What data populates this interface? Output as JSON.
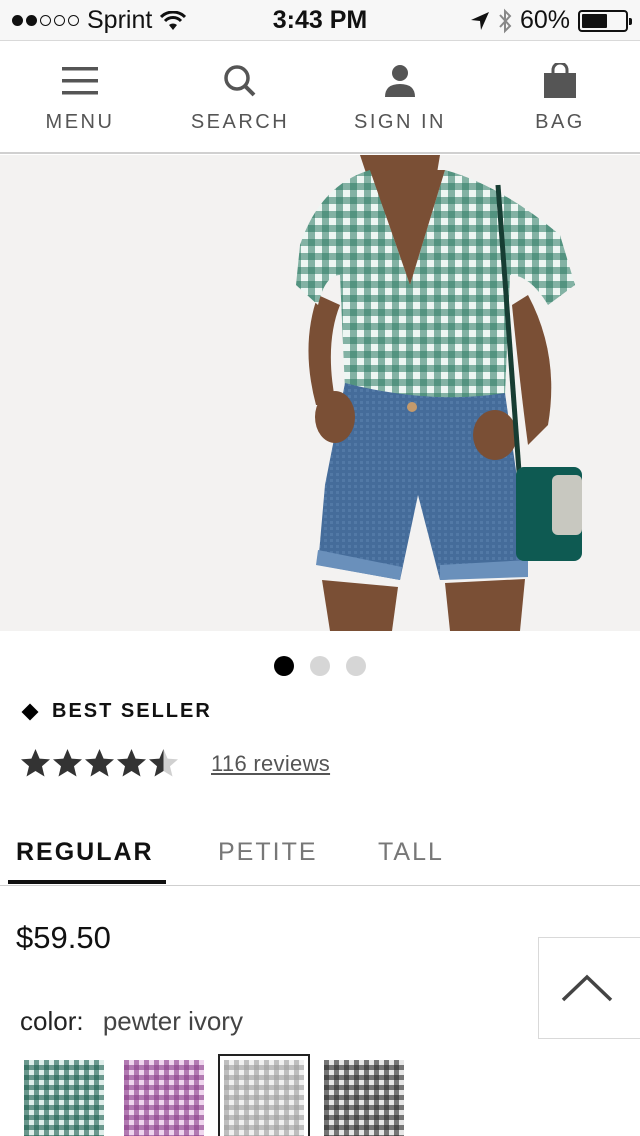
{
  "status": {
    "carrier": "Sprint",
    "time": "3:43 PM",
    "battery_text": "60%",
    "battery_level": 0.6
  },
  "nav": {
    "menu": "MENU",
    "search": "SEARCH",
    "sign_in": "SIGN IN",
    "bag": "BAG"
  },
  "carousel": {
    "count": 3,
    "active": 1
  },
  "badge": {
    "label": "BEST SELLER"
  },
  "rating": {
    "stars": 4.5,
    "max": 5,
    "reviews_link": "116 reviews"
  },
  "fit_tabs": [
    {
      "label": "REGULAR",
      "active": true
    },
    {
      "label": "PETITE",
      "active": false
    },
    {
      "label": "TALL",
      "active": false
    }
  ],
  "price": "$59.50",
  "color": {
    "label": "color:",
    "value": "pewter ivory"
  },
  "swatches": [
    {
      "name": "green gingham",
      "base": "#dfeeea",
      "stripe": "#1d5f4f",
      "selected": false
    },
    {
      "name": "purple gingham",
      "base": "#efd6ee",
      "stripe": "#8a3d8a",
      "selected": false
    },
    {
      "name": "pewter ivory",
      "base": "#f0f0f0",
      "stripe": "#9c9c9c",
      "selected": true
    },
    {
      "name": "black gingham",
      "base": "#e6e6e6",
      "stripe": "#2a2a2a",
      "selected": false
    }
  ],
  "colors": {
    "accent": "#000000",
    "muted": "#777777"
  },
  "icons": [
    "menu-icon",
    "search-icon",
    "user-icon",
    "bag-icon",
    "chevron-up-icon",
    "location-arrow-icon",
    "bluetooth-icon",
    "wifi-icon"
  ]
}
